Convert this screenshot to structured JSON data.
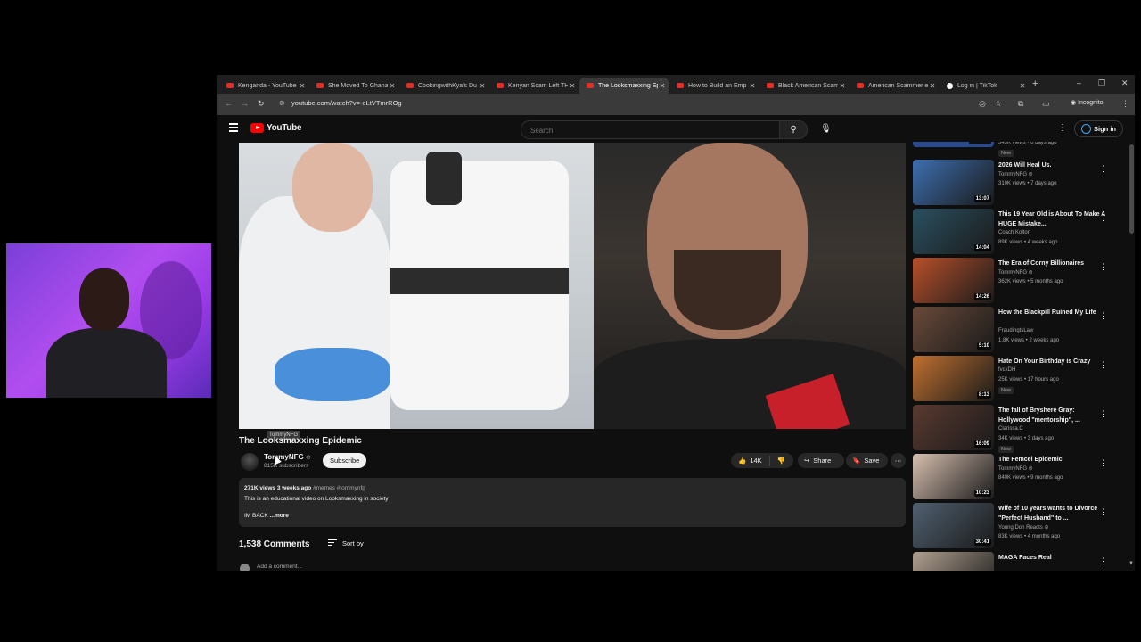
{
  "tabs": [
    {
      "label": "Kenganda - YouTube",
      "icon": "youtube"
    },
    {
      "label": "She Moved To Ghana",
      "icon": "youtube"
    },
    {
      "label": "CookingwithKya's Du",
      "icon": "youtube"
    },
    {
      "label": "Kenyan Scam Left TH",
      "icon": "youtube"
    },
    {
      "label": "The Looksmaxxing Ep",
      "icon": "youtube",
      "active": true
    },
    {
      "label": "How to Build an Emp",
      "icon": "youtube"
    },
    {
      "label": "Black American Scam",
      "icon": "youtube"
    },
    {
      "label": "American Scammer e",
      "icon": "youtube"
    },
    {
      "label": "Log in | TikTok",
      "icon": "tiktok"
    }
  ],
  "address": {
    "url": "youtube.com/watch?v=-eLtVTmrROg",
    "incognito_label": "Incognito"
  },
  "header": {
    "logo_text": "YouTube",
    "search_placeholder": "Search",
    "signin_label": "Sign in"
  },
  "video": {
    "tooltip": "TommyNFG",
    "title": "The Looksmaxxing Epidemic",
    "channel": "TommyNFG",
    "subscribers": "815K subscribers",
    "subscribe_label": "Subscribe",
    "likes": "14K",
    "share_label": "Share",
    "save_label": "Save",
    "views": "271K views",
    "age": "3 weeks ago",
    "tags": "#memes #tommynfg",
    "description": "This is an educational video on Looksmaxxing in society",
    "description_line2": "IM BACK",
    "more_label": "...more",
    "comment_count": "1,538 Comments",
    "sort_label": "Sort by",
    "add_comment": "Add a comment..."
  },
  "sidebar": {
    "top_partial": {
      "views": "343K views • 6 days ago",
      "duration": "1:01:04",
      "badge": "New"
    },
    "items": [
      {
        "title": "2026 Will Heal Us.",
        "channel": "TommyNFG",
        "verified": true,
        "meta": "310K views • 7 days ago",
        "duration": "13:07",
        "badge": ""
      },
      {
        "title": "This 19 Year Old is About To Make A HUGE Mistake...",
        "channel": "Coach Kolton",
        "verified": false,
        "meta": "89K views • 4 weeks ago",
        "duration": "14:04",
        "badge": ""
      },
      {
        "title": "The Era of Corny Billionaires",
        "channel": "TommyNFG",
        "verified": true,
        "meta": "362K views • 5 months ago",
        "duration": "14:26",
        "badge": ""
      },
      {
        "title": "How the Blackpill Ruined My Life",
        "channel": "FraudingtsLaw",
        "verified": false,
        "meta": "1.8K views • 2 weeks ago",
        "duration": "5:10",
        "badge": ""
      },
      {
        "title": "Hate On Your Birthday is Crazy",
        "channel": "fvckDH",
        "verified": false,
        "meta": "25K views • 17 hours ago",
        "duration": "8:13",
        "badge": "New"
      },
      {
        "title": "The fall of Bryshere Gray: Hollywood \"mentorship\", ...",
        "channel": "Clarissa.C",
        "verified": false,
        "meta": "34K views • 3 days ago",
        "duration": "16:09",
        "badge": "New"
      },
      {
        "title": "The Femcel Epidemic",
        "channel": "TommyNFG",
        "verified": true,
        "meta": "840K views • 9 months ago",
        "duration": "10:23",
        "badge": ""
      },
      {
        "title": "Wife of 10 years wants to Divorce \"Perfect Husband\" to ...",
        "channel": "Young Don Reacts",
        "verified": true,
        "meta": "83K views • 4 months ago",
        "duration": "30:41",
        "badge": ""
      },
      {
        "title": "MAGA Faces Real",
        "channel": "",
        "verified": false,
        "meta": "",
        "duration": "",
        "badge": ""
      }
    ]
  },
  "thumb_colors": [
    "#3d6fb0",
    "#2a5060",
    "#b8502a",
    "#6a4a3a",
    "#c07030",
    "#5a3a30",
    "#d8c0b0",
    "#506070",
    "#b0a090"
  ],
  "colors": {
    "accent_red": "#ff0000",
    "link_blue": "#3ea6ff",
    "bg": "#0f0f0f"
  }
}
